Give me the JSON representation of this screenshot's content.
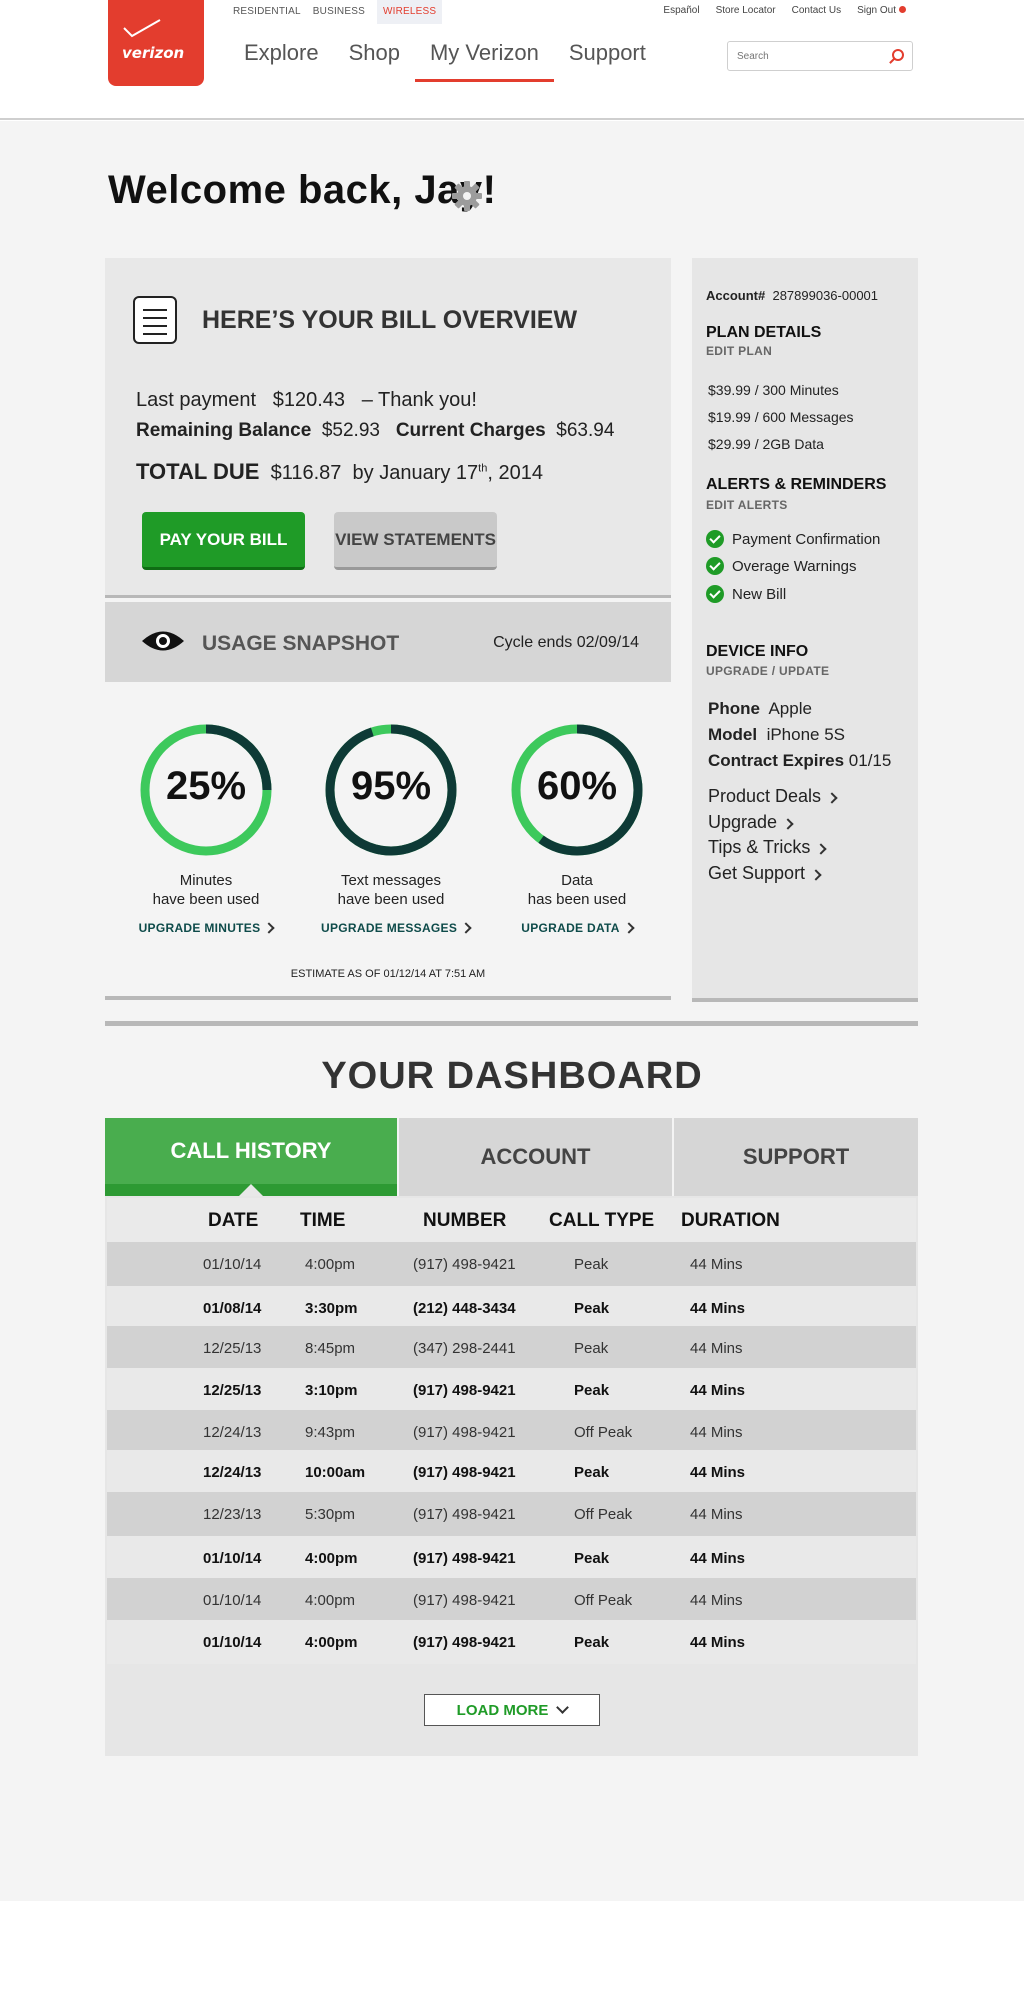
{
  "header": {
    "segments": [
      "RESIDENTIAL",
      "BUSINESS",
      "WIRELESS"
    ],
    "active_segment": "WIRELESS",
    "utility_links": [
      "Español",
      "Store Locator",
      "Contact Us",
      "Sign Out"
    ],
    "logo_text": "verizon",
    "nav": [
      "Explore",
      "Shop",
      "My Verizon",
      "Support"
    ],
    "active_nav": "My Verizon",
    "search_placeholder": "Search",
    "brand_color": "#e33d2e"
  },
  "welcome": {
    "text": "Welcome back, Jay!"
  },
  "bill": {
    "title": "HERE’S YOUR BILL OVERVIEW",
    "last_payment_label": "Last payment",
    "last_payment_value": "$120.43",
    "thanks": "– Thank you!",
    "remaining_label": "Remaining Balance",
    "remaining_value": "$52.93",
    "current_label": "Current Charges",
    "current_value": "$63.94",
    "total_label": "TOTAL DUE",
    "total_value": "$116.87",
    "due_by": "by January 17",
    "due_sup": "th",
    "due_year": ", 2014",
    "pay_button": "PAY YOUR BILL",
    "statements_button": "VIEW STATEMENTS",
    "accent_color": "#1f9b27"
  },
  "usage": {
    "title": "USAGE SNAPSHOT",
    "cycle": "Cycle ends 02/09/14",
    "gauges": [
      {
        "percent": 25,
        "label": "25%",
        "line1": "Minutes",
        "line2": "have been used",
        "upgrade": "UPGRADE MINUTES"
      },
      {
        "percent": 95,
        "label": "95%",
        "line1": "Text messages",
        "line2": "have been used",
        "upgrade": "UPGRADE MESSAGES"
      },
      {
        "percent": 60,
        "label": "60%",
        "line1": "Data",
        "line2": "has been used",
        "upgrade": "UPGRADE DATA"
      }
    ],
    "estimate": "ESTIMATE AS OF 01/12/14 AT 7:51 AM",
    "used_color": "#0e3a36",
    "remaining_color": "#3dc95c"
  },
  "sidebar": {
    "account_label": "Account#",
    "account_number": "287899036-00001",
    "plan_title": "PLAN DETAILS",
    "plan_edit": "EDIT PLAN",
    "plan_items": [
      "$39.99 / 300 Minutes",
      "$19.99 / 600 Messages",
      "$29.99 / 2GB Data"
    ],
    "alerts_title": "ALERTS & REMINDERS",
    "alerts_edit": "EDIT ALERTS",
    "alerts": [
      "Payment Confirmation",
      "Overage Warnings",
      "New Bill"
    ],
    "device_title": "DEVICE INFO",
    "device_edit": "UPGRADE / UPDATE",
    "phone_label": "Phone",
    "phone_value": "Apple",
    "model_label": "Model",
    "model_value": "iPhone 5S",
    "contract_label": "Contract Expires",
    "contract_value": "01/15",
    "links": [
      "Product Deals",
      "Upgrade",
      "Tips & Tricks",
      "Get Support"
    ]
  },
  "dashboard": {
    "title": "YOUR DASHBOARD",
    "tabs": [
      "CALL HISTORY",
      "ACCOUNT",
      "SUPPORT"
    ],
    "active_tab": "CALL HISTORY",
    "columns": [
      "DATE",
      "TIME",
      "NUMBER",
      "CALL TYPE",
      "DURATION"
    ],
    "rows": [
      {
        "date": "01/10/14",
        "time": "4:00pm",
        "number": "(917) 498-9421",
        "type": "Peak",
        "duration": "44 Mins",
        "bold": false
      },
      {
        "date": "01/08/14",
        "time": "3:30pm",
        "number": "(212) 448-3434",
        "type": "Peak",
        "duration": "44 Mins",
        "bold": true
      },
      {
        "date": "12/25/13",
        "time": "8:45pm",
        "number": "(347) 298-2441",
        "type": "Peak",
        "duration": "44 Mins",
        "bold": false
      },
      {
        "date": "12/25/13",
        "time": "3:10pm",
        "number": "(917) 498-9421",
        "type": "Peak",
        "duration": "44 Mins",
        "bold": true
      },
      {
        "date": "12/24/13",
        "time": "9:43pm",
        "number": "(917) 498-9421",
        "type": "Off Peak",
        "duration": "44 Mins",
        "bold": false
      },
      {
        "date": "12/24/13",
        "time": "10:00am",
        "number": "(917) 498-9421",
        "type": "Peak",
        "duration": "44 Mins",
        "bold": true
      },
      {
        "date": "12/23/13",
        "time": "5:30pm",
        "number": "(917) 498-9421",
        "type": "Off Peak",
        "duration": "44 Mins",
        "bold": false
      },
      {
        "date": "01/10/14",
        "time": "4:00pm",
        "number": "(917) 498-9421",
        "type": "Peak",
        "duration": "44 Mins",
        "bold": true
      },
      {
        "date": "01/10/14",
        "time": "4:00pm",
        "number": "(917) 498-9421",
        "type": "Off Peak",
        "duration": "44 Mins",
        "bold": false
      },
      {
        "date": "01/10/14",
        "time": "4:00pm",
        "number": "(917) 498-9421",
        "type": "Peak",
        "duration": "44 Mins",
        "bold": true
      }
    ],
    "load_more": "LOAD MORE"
  }
}
